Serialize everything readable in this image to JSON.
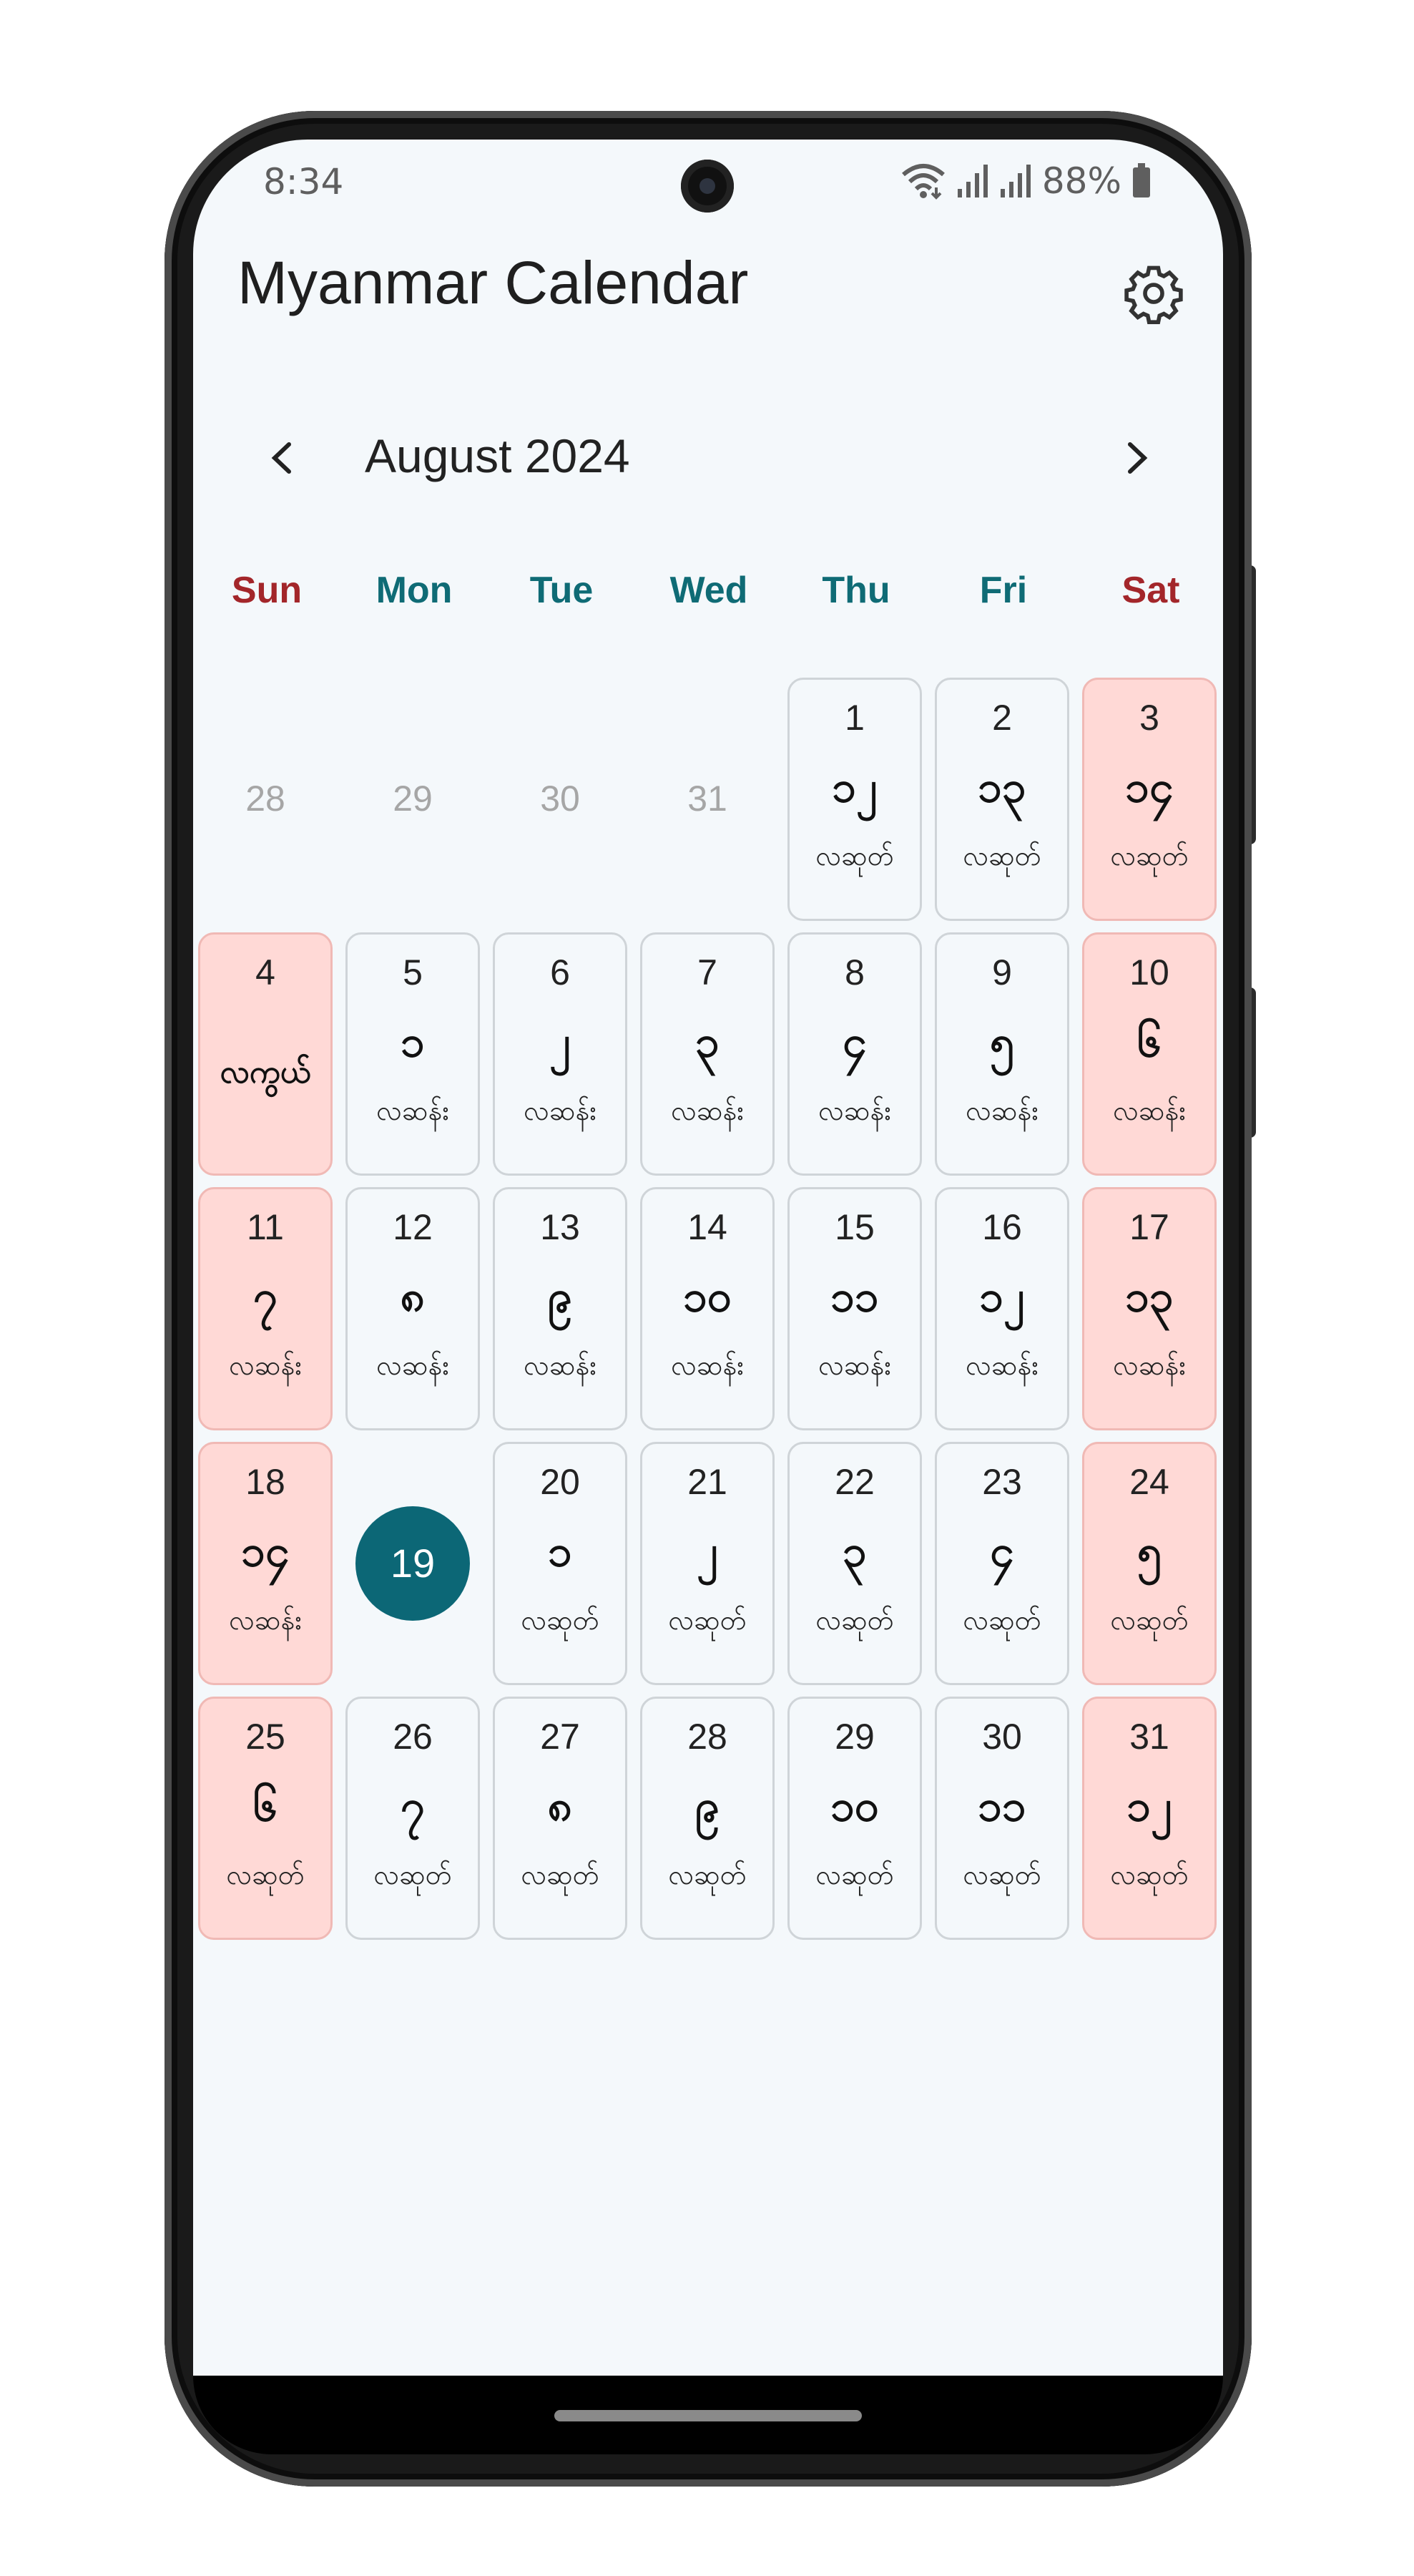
{
  "status_bar": {
    "time": "8:34",
    "battery": "88%"
  },
  "app": {
    "title": "Myanmar Calendar"
  },
  "calendar": {
    "month_label": "August 2024",
    "weekdays": [
      "Sun",
      "Mon",
      "Tue",
      "Wed",
      "Thu",
      "Fri",
      "Sat"
    ],
    "weekend_color": "#a3262a",
    "weekday_color": "#0f6b75",
    "accent_color": "#0c6776",
    "holiday_color": "#ffd9d6",
    "leading_days": [
      "28",
      "29",
      "30",
      "31"
    ],
    "today": "19",
    "days": [
      {
        "d": "1",
        "m": "၁၂",
        "p": "လဆုတ်",
        "h": false
      },
      {
        "d": "2",
        "m": "၁၃",
        "p": "လဆုတ်",
        "h": false
      },
      {
        "d": "3",
        "m": "၁၄",
        "p": "လဆုတ်",
        "h": true
      },
      {
        "d": "4",
        "big": "လကွယ်",
        "h": true
      },
      {
        "d": "5",
        "m": "၁",
        "p": "လဆန်း",
        "h": false
      },
      {
        "d": "6",
        "m": "၂",
        "p": "လဆန်း",
        "h": false
      },
      {
        "d": "7",
        "m": "၃",
        "p": "လဆန်း",
        "h": false
      },
      {
        "d": "8",
        "m": "၄",
        "p": "လဆန်း",
        "h": false
      },
      {
        "d": "9",
        "m": "၅",
        "p": "လဆန်း",
        "h": false
      },
      {
        "d": "10",
        "m": "၆",
        "p": "လဆန်း",
        "h": true
      },
      {
        "d": "11",
        "m": "၇",
        "p": "လဆန်း",
        "h": true
      },
      {
        "d": "12",
        "m": "၈",
        "p": "လဆန်း",
        "h": false
      },
      {
        "d": "13",
        "m": "၉",
        "p": "လဆန်း",
        "h": false
      },
      {
        "d": "14",
        "m": "၁၀",
        "p": "လဆန်း",
        "h": false
      },
      {
        "d": "15",
        "m": "၁၁",
        "p": "လဆန်း",
        "h": false
      },
      {
        "d": "16",
        "m": "၁၂",
        "p": "လဆန်း",
        "h": false
      },
      {
        "d": "17",
        "m": "၁၃",
        "p": "လဆန်း",
        "h": true
      },
      {
        "d": "18",
        "m": "၁၄",
        "p": "လဆန်း",
        "h": true
      },
      {
        "d": "19",
        "today": true
      },
      {
        "d": "20",
        "m": "၁",
        "p": "လဆုတ်",
        "h": false
      },
      {
        "d": "21",
        "m": "၂",
        "p": "လဆုတ်",
        "h": false
      },
      {
        "d": "22",
        "m": "၃",
        "p": "လဆုတ်",
        "h": false
      },
      {
        "d": "23",
        "m": "၄",
        "p": "လဆုတ်",
        "h": false
      },
      {
        "d": "24",
        "m": "၅",
        "p": "လဆုတ်",
        "h": true
      },
      {
        "d": "25",
        "m": "၆",
        "p": "လဆုတ်",
        "h": true
      },
      {
        "d": "26",
        "m": "၇",
        "p": "လဆုတ်",
        "h": false
      },
      {
        "d": "27",
        "m": "၈",
        "p": "လဆုတ်",
        "h": false
      },
      {
        "d": "28",
        "m": "၉",
        "p": "လဆုတ်",
        "h": false
      },
      {
        "d": "29",
        "m": "၁၀",
        "p": "လဆုတ်",
        "h": false
      },
      {
        "d": "30",
        "m": "၁၁",
        "p": "လဆုတ်",
        "h": false
      },
      {
        "d": "31",
        "m": "၁၂",
        "p": "လဆုတ်",
        "h": true
      }
    ]
  },
  "icons": {
    "settings": "gear-icon",
    "prev": "chevron-left-icon",
    "next": "chevron-right-icon",
    "wifi": "wifi-icon",
    "signal": "signal-icon",
    "battery": "battery-icon"
  }
}
